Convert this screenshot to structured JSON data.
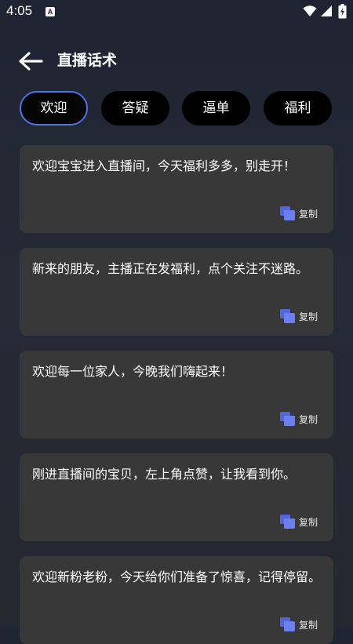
{
  "status_bar": {
    "time": "4:05",
    "notification_icon": "a-icon",
    "icons": [
      "wifi-icon",
      "signal-icon",
      "battery-charging-icon"
    ]
  },
  "header": {
    "back_icon": "arrow-left-icon",
    "title": "直播话术"
  },
  "tabs": [
    {
      "label": "欢迎",
      "active": true
    },
    {
      "label": "答疑",
      "active": false
    },
    {
      "label": "逼单",
      "active": false
    },
    {
      "label": "福利",
      "active": false
    }
  ],
  "phrases": [
    {
      "text": "欢迎宝宝进入直播间，今天福利多多，别走开！",
      "copy_label": "复制"
    },
    {
      "text": "新来的朋友，主播正在发福利，点个关注不迷路。",
      "copy_label": "复制"
    },
    {
      "text": "欢迎每一位家人，今晚我们嗨起来！",
      "copy_label": "复制"
    },
    {
      "text": "刚进直播间的宝贝，左上角点赞，让我看到你。",
      "copy_label": "复制"
    },
    {
      "text": "欢迎新粉老粉，今天给你们准备了惊喜，记得停留。",
      "copy_label": "复制"
    }
  ],
  "colors": {
    "background": "#23262f",
    "card": "#383838",
    "tab": "#000000",
    "accent": "#4a74e8",
    "copy_icon": "#5b72e8"
  }
}
